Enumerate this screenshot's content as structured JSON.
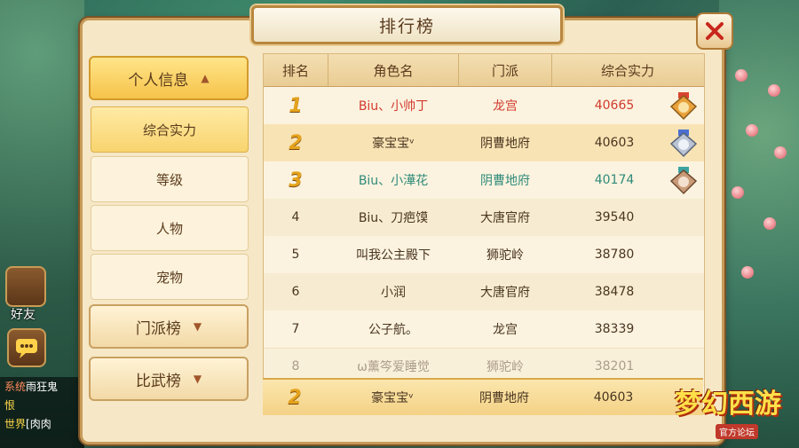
{
  "window": {
    "title": "排行榜"
  },
  "menu": {
    "categories": [
      {
        "label": "个人信息",
        "expanded": true
      },
      {
        "label": "门派榜",
        "expanded": false
      },
      {
        "label": "比武榜",
        "expanded": false
      }
    ],
    "sub_items": [
      {
        "label": "综合实力",
        "active": true
      },
      {
        "label": "等级",
        "active": false
      },
      {
        "label": "人物",
        "active": false
      },
      {
        "label": "宠物",
        "active": false
      }
    ]
  },
  "table": {
    "headers": [
      "排名",
      "角色名",
      "门派",
      "综合实力"
    ],
    "rows": [
      {
        "rank": "1",
        "name": "Biu、小帅丁",
        "school": "龙宫",
        "power": "40665"
      },
      {
        "rank": "2",
        "name": "豪宝宝ᵛ",
        "school": "阴曹地府",
        "power": "40603"
      },
      {
        "rank": "3",
        "name": "Biu、小澕花",
        "school": "阴曹地府",
        "power": "40174"
      },
      {
        "rank": "4",
        "name": "Biu、刀疤馍",
        "school": "大唐官府",
        "power": "39540"
      },
      {
        "rank": "5",
        "name": "叫我公主殿下",
        "school": "狮驼岭",
        "power": "38780"
      },
      {
        "rank": "6",
        "name": "小润",
        "school": "大唐官府",
        "power": "38478"
      },
      {
        "rank": "7",
        "name": "公子航。",
        "school": "龙宫",
        "power": "38339"
      },
      {
        "rank": "8",
        "name": "ω薰笒爱睡觉",
        "school": "狮驼岭",
        "power": "38201"
      }
    ],
    "self_row": {
      "rank": "2",
      "name": "豪宝宝ᵛ",
      "school": "阴曹地府",
      "power": "40603"
    }
  },
  "hud": {
    "friend_label": "好友",
    "chat": [
      {
        "tag": "系统",
        "text": "雨狂鬼"
      },
      {
        "tag": "",
        "text": "恨"
      },
      {
        "tag": "世界",
        "text": "[肉肉"
      }
    ]
  },
  "logo": {
    "main": "梦幻西游",
    "sub": "官方论坛"
  },
  "colors": {
    "accent": "#f6c34a",
    "rank1_text": "#d23a2e",
    "rank3_text": "#2f8a7a",
    "border": "#c79a58"
  }
}
